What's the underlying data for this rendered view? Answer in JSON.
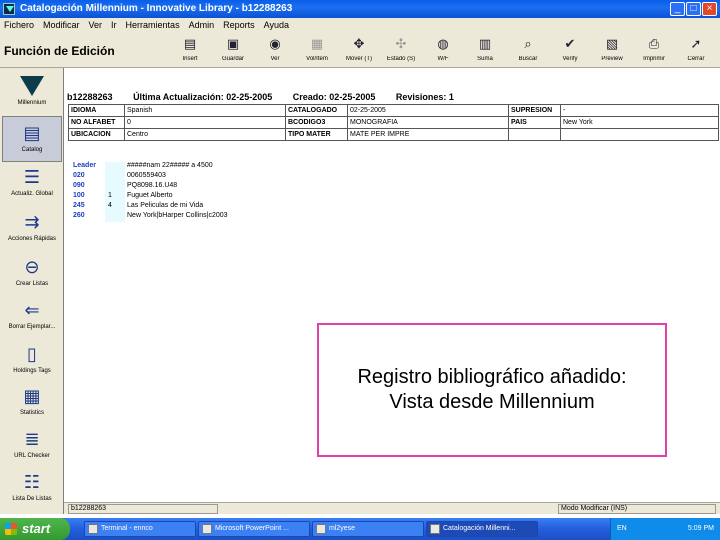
{
  "window": {
    "title": "Catalogación Millennium - Innovative Library - b12288263"
  },
  "menu": [
    "Fichero",
    "Modificar",
    "Ver",
    "Ir",
    "Herramientas",
    "Admin",
    "Reports",
    "Ayuda"
  ],
  "toolbar": {
    "function_title": "Función de Edición",
    "buttons": [
      {
        "label": "Insert",
        "icon": "insert-icon"
      },
      {
        "label": "Guardar",
        "icon": "save-icon"
      },
      {
        "label": "Ver",
        "icon": "view-icon"
      },
      {
        "label": "Vol/Ítem",
        "icon": "volume-icon"
      },
      {
        "label": "Mover (T)",
        "icon": "move-icon"
      },
      {
        "label": "Estado (S)",
        "icon": "status-icon"
      },
      {
        "label": "W/F",
        "icon": "globe-icon"
      },
      {
        "label": "Suma",
        "icon": "summary-icon"
      },
      {
        "label": "Buscar",
        "icon": "search-icon"
      },
      {
        "label": "Verify",
        "icon": "verify-icon"
      },
      {
        "label": "Preview",
        "icon": "preview-icon"
      },
      {
        "label": "Imprimir",
        "icon": "print-icon"
      },
      {
        "label": "Cerrar",
        "icon": "close-icon"
      }
    ]
  },
  "sidebar": [
    {
      "label": "Millennium",
      "icon": "millennium-logo"
    },
    {
      "label": "Catalog",
      "icon": "catalog-icon"
    },
    {
      "label": "Actualiz. Global",
      "icon": "global-update-icon"
    },
    {
      "label": "Acciones Rápidas",
      "icon": "rapid-update-icon"
    },
    {
      "label": "Crear Listas",
      "icon": "create-lists-icon"
    },
    {
      "label": "Borrar Ejemplar...",
      "icon": "delete-item-icon"
    },
    {
      "label": "Holdings Tags",
      "icon": "holdings-icon"
    },
    {
      "label": "Statistics",
      "icon": "statistics-icon"
    },
    {
      "label": "URL Checker",
      "icon": "url-checker-icon"
    },
    {
      "label": "Lista De Listas",
      "icon": "list-icon"
    }
  ],
  "record": {
    "number": "b12288263",
    "last_update": "Última Actualización: 02-25-2005",
    "created": "Creado: 02-25-2005",
    "revisions": "Revisiones: 1"
  },
  "fixed_fields": [
    [
      "IDIOMA",
      "Spanish",
      "CATALOGADO",
      "02-25-2005",
      "SUPRESION",
      "-"
    ],
    [
      "NO ALFABET",
      "0",
      "BCODIGO3",
      "MONOGRAFIA",
      "PAIS",
      "New York"
    ],
    [
      "UBICACION",
      "Centro",
      "TIPO MATER",
      "MATE PER IMPRE",
      "",
      ""
    ]
  ],
  "marc_fields": [
    {
      "tag": "Leader",
      "ind1": "",
      "value": "#####nam  22##### a 4500"
    },
    {
      "tag": "020",
      "ind1": "",
      "value": "0060559403"
    },
    {
      "tag": "090",
      "ind1": "",
      "value": "PQ8098.16.U48"
    },
    {
      "tag": "100",
      "ind1": "1",
      "value": "Fuguet Alberto"
    },
    {
      "tag": "245",
      "ind1": "4",
      "value": "Las Peliculas de mi Vida"
    },
    {
      "tag": "260",
      "ind1": "",
      "value": "New York|bHarper Collins|c2003"
    }
  ],
  "caption": {
    "line1": "Registro bibliográfico añadido:",
    "line2": "Vista desde Millennium"
  },
  "status": {
    "left": "b12288263",
    "right": "Modo Modificar (INS)"
  },
  "taskbar": {
    "start": "start",
    "tasks": [
      "Terminal - ennco",
      "Microsoft PowerPoint ...",
      "ml2yese",
      "Catalogación Millenni..."
    ],
    "tray_lang": "EN",
    "time": "5:09 PM"
  }
}
